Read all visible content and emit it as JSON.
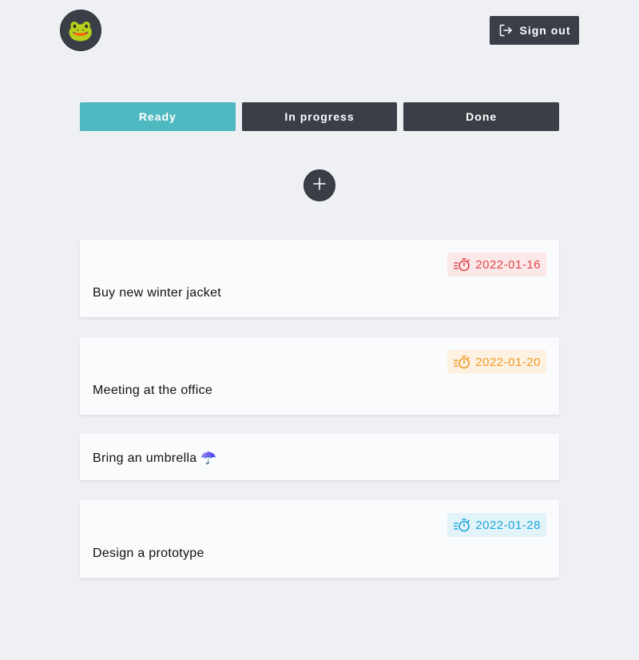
{
  "header": {
    "avatar_emoji": "🐸",
    "signout_label": "Sign out"
  },
  "tabs": [
    {
      "label": "Ready",
      "active": true
    },
    {
      "label": "In progress",
      "active": false
    },
    {
      "label": "Done",
      "active": false
    }
  ],
  "tasks": [
    {
      "title": "Buy new winter jacket",
      "due": "2022-01-16",
      "status_color": "#e0464a",
      "badge_bg": "#fbe9e9"
    },
    {
      "title": "Meeting at the office",
      "due": "2022-01-20",
      "status_color": "#f09a24",
      "badge_bg": "#fdf1e1"
    },
    {
      "title": "Bring an umbrella ☂️",
      "due": null
    },
    {
      "title": "Design a prototype",
      "due": "2022-01-28",
      "status_color": "#1ea8da",
      "badge_bg": "#e3f3fa"
    }
  ],
  "colors": {
    "accent": "#4fb9c2",
    "dark": "#3a3f47",
    "background": "#eef0f4"
  }
}
